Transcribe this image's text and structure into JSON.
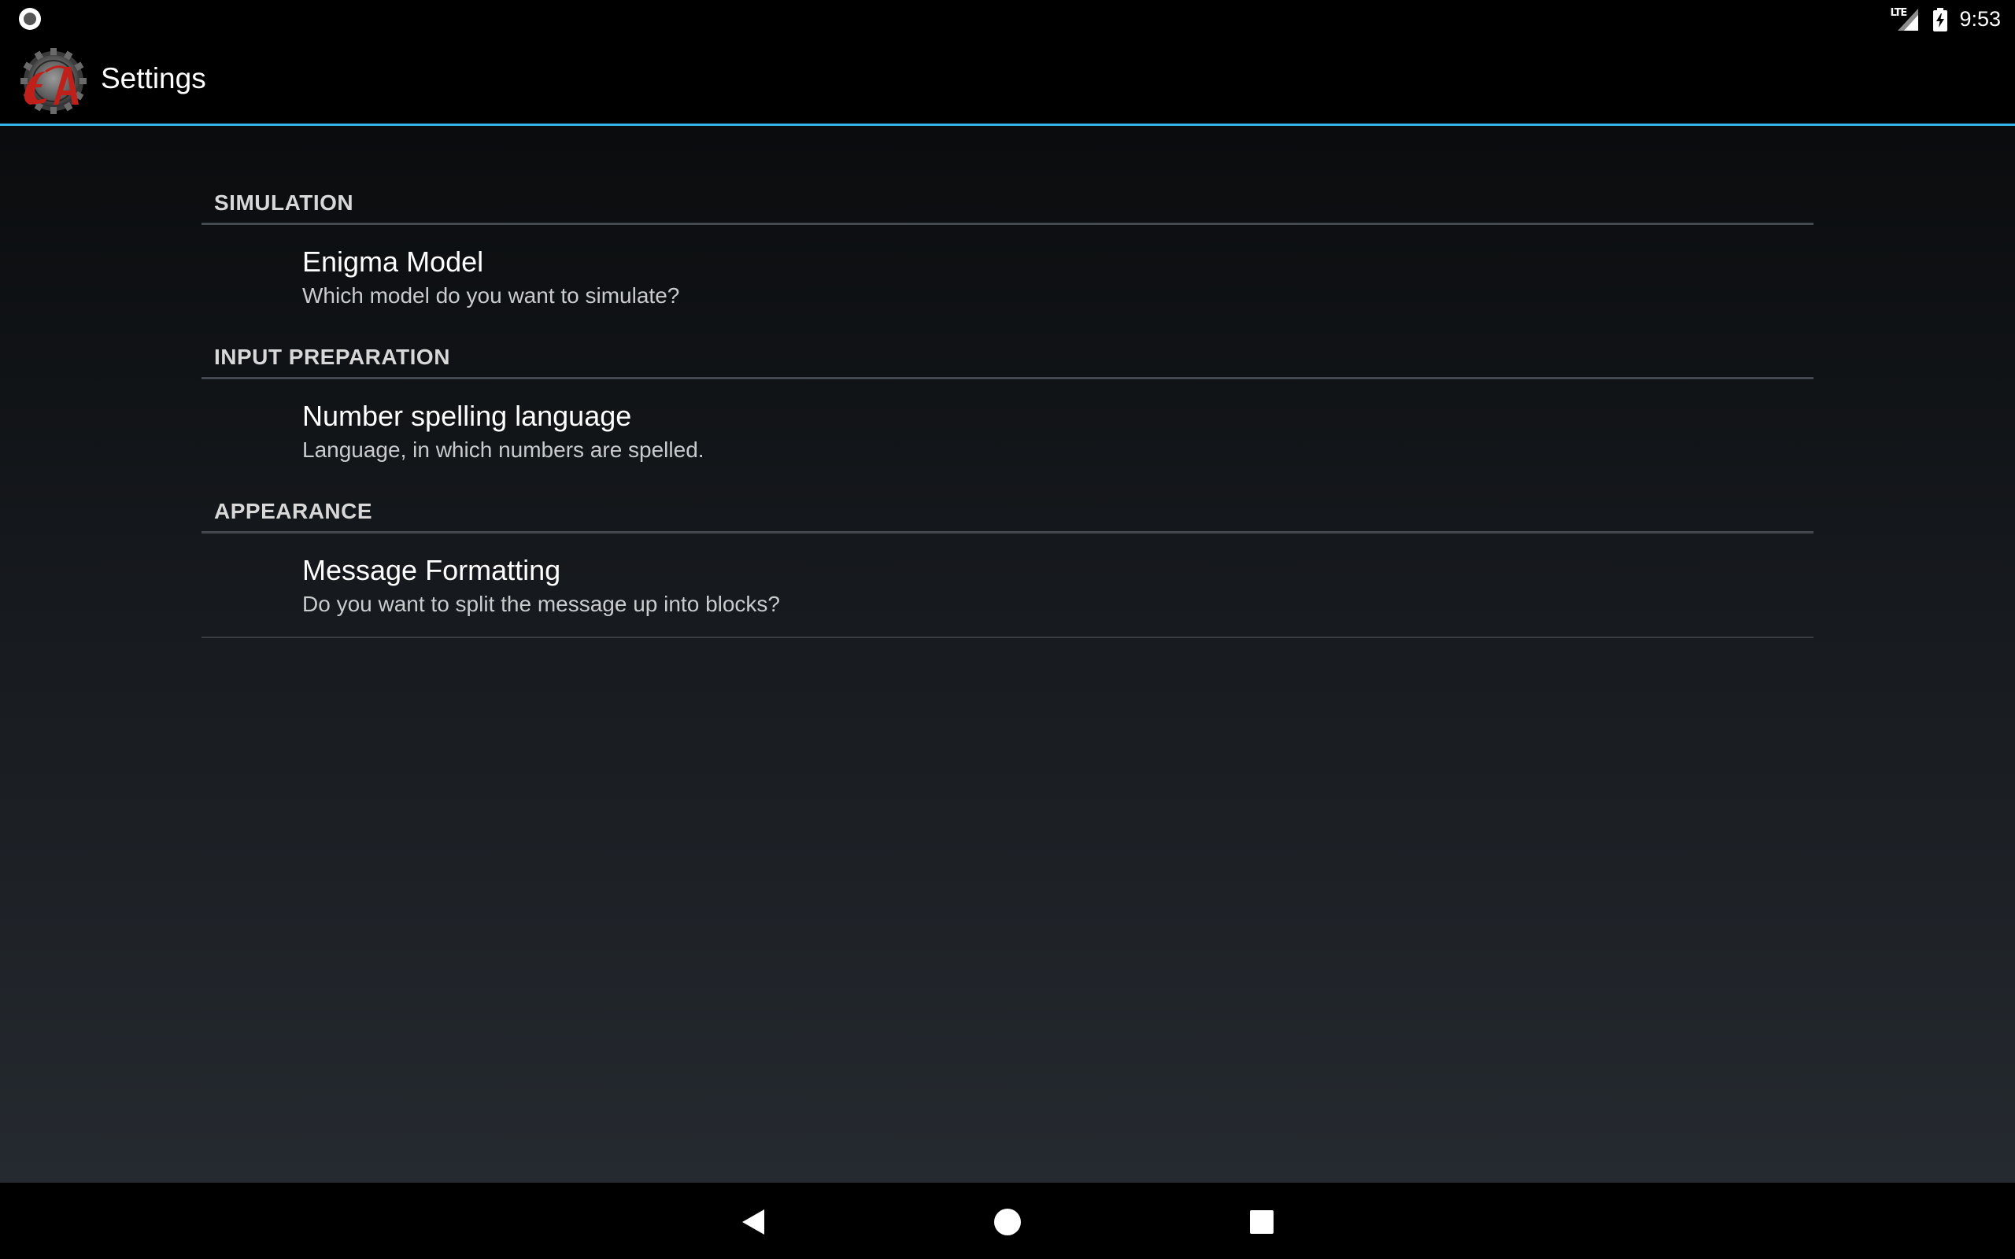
{
  "status_bar": {
    "network_label": "LTE",
    "time": "9:53"
  },
  "action_bar": {
    "title": "Settings",
    "logo_icon": "enigma-app-logo"
  },
  "categories": [
    {
      "header": "SIMULATION",
      "items": [
        {
          "title": "Enigma Model",
          "summary": "Which model do you want to simulate?"
        }
      ]
    },
    {
      "header": "INPUT PREPARATION",
      "items": [
        {
          "title": "Number spelling language",
          "summary": "Language, in which numbers are spelled."
        }
      ]
    },
    {
      "header": "APPEARANCE",
      "items": [
        {
          "title": "Message Formatting",
          "summary": "Do you want to split the message up into blocks?"
        }
      ]
    }
  ],
  "nav_bar": {
    "back_icon": "back-triangle-icon",
    "home_icon": "home-circle-icon",
    "recents_icon": "recents-square-icon"
  },
  "colors": {
    "accent": "#33b5e5",
    "logo_red": "#c0201a"
  }
}
